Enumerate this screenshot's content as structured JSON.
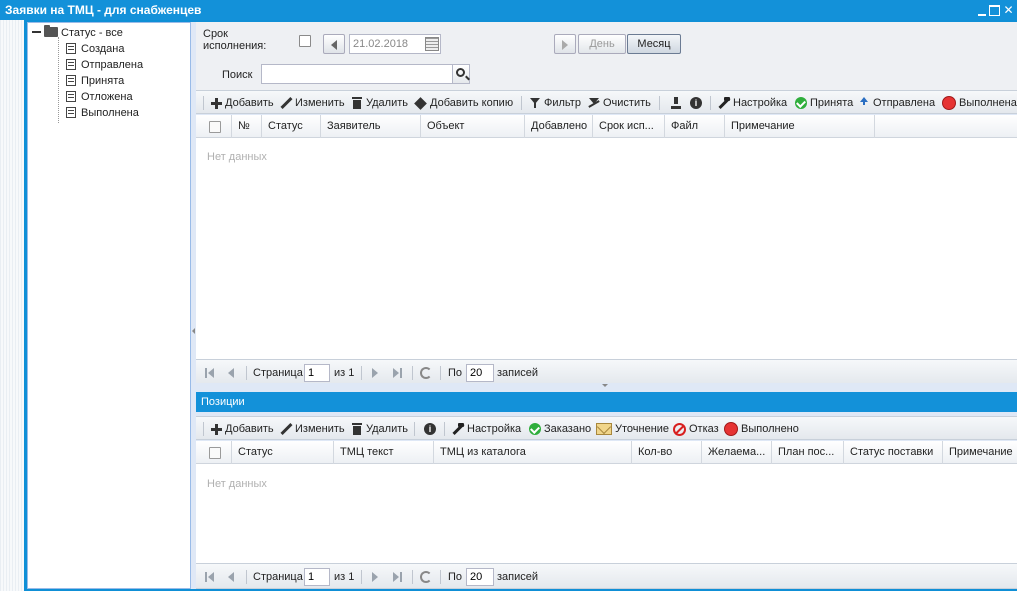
{
  "window": {
    "title": "Заявки на ТМЦ - для снабженцев"
  },
  "tree": {
    "root_label": "Статус - все",
    "items": [
      "Создана",
      "Отправлена",
      "Принята",
      "Отложена",
      "Выполнена"
    ]
  },
  "filter": {
    "deadline_label": "Срок исполнения:",
    "date_value": "21.02.2018",
    "day_label": "День",
    "month_label": "Месяц",
    "search_label": "Поиск",
    "search_value": ""
  },
  "top_toolbar": {
    "add": "Добавить",
    "edit": "Изменить",
    "delete": "Удалить",
    "add_copy": "Добавить копию",
    "filter": "Фильтр",
    "clear": "Очистить",
    "settings": "Настройка",
    "accepted": "Принята",
    "sent": "Отправлена",
    "done": "Выполнена"
  },
  "top_grid": {
    "columns": [
      "№",
      "Статус",
      "Заявитель",
      "Объект",
      "Добавлено",
      "Срок исп...",
      "Файл",
      "Примечание"
    ],
    "empty_text": "Нет данных"
  },
  "pager": {
    "page_label": "Страница",
    "page_value": "1",
    "of_label": "из 1",
    "per_label": "По",
    "per_value": "20",
    "records_label": "записей"
  },
  "positions": {
    "title": "Позиции",
    "toolbar": {
      "add": "Добавить",
      "edit": "Изменить",
      "delete": "Удалить",
      "settings": "Настройка",
      "ordered": "Заказано",
      "clarify": "Уточнение",
      "refuse": "Отказ",
      "done": "Выполнено"
    },
    "columns": [
      "Статус",
      "ТМЦ текст",
      "ТМЦ из каталога",
      "Кол-во",
      "Желаема...",
      "План пос...",
      "Статус поставки",
      "Примечание"
    ],
    "empty_text": "Нет данных"
  },
  "colors": {
    "accent": "#1391d9",
    "panel_bg": "#dfe8f6"
  }
}
